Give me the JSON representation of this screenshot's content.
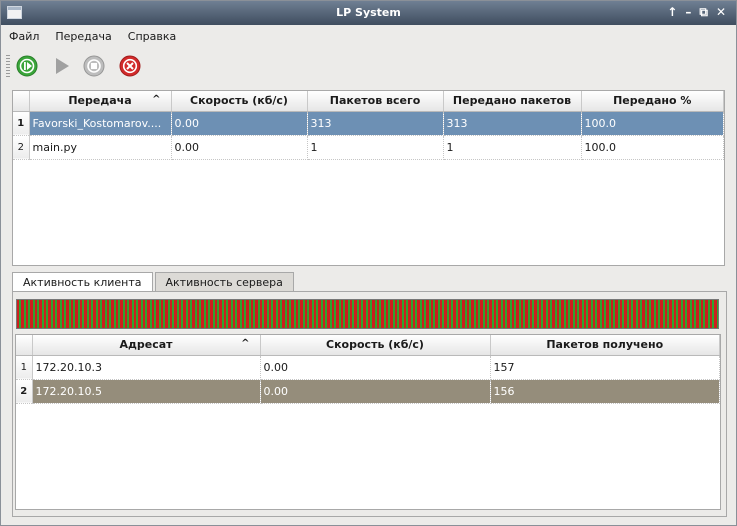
{
  "window": {
    "title": "LP System",
    "controls": [
      "↑",
      "–",
      "⧉",
      "✕"
    ]
  },
  "menu": [
    "Файл",
    "Передача",
    "Справка"
  ],
  "toolbar": {
    "buttons": [
      {
        "name": "start-transfer-icon",
        "color": "#3aa53a"
      },
      {
        "name": "play-icon",
        "color": "#9e9e9e"
      },
      {
        "name": "stop-icon",
        "color": "#a6a6a6"
      },
      {
        "name": "cancel-icon",
        "color": "#d22b2b"
      }
    ]
  },
  "transfers": {
    "columns": [
      "Передача",
      "Скорость (кб/с)",
      "Пакетов всего",
      "Передано пакетов",
      "Передано %"
    ],
    "sort_indicator": "^",
    "rows": [
      {
        "num": "1",
        "name": "Favorski_Kostomarov....",
        "speed": "0.00",
        "total": "313",
        "sent": "313",
        "percent": "100.0",
        "selected": true
      },
      {
        "num": "2",
        "name": "main.py",
        "speed": "0.00",
        "total": "1",
        "sent": "1",
        "percent": "100.0",
        "selected": false
      }
    ]
  },
  "tabs": {
    "client": "Активность клиента",
    "server": "Активность сервера",
    "active": "client"
  },
  "activity_bar": {
    "colors": [
      "#cc1f1f",
      "#2ea52e"
    ]
  },
  "clients": {
    "columns": [
      "Адресат",
      "Скорость (кб/с)",
      "Пакетов получено"
    ],
    "sort_indicator": "^",
    "rows": [
      {
        "num": "1",
        "address": "172.20.10.3",
        "speed": "0.00",
        "received": "157",
        "selected": false
      },
      {
        "num": "2",
        "address": "172.20.10.5",
        "speed": "0.00",
        "received": "156",
        "selected": true
      }
    ]
  }
}
